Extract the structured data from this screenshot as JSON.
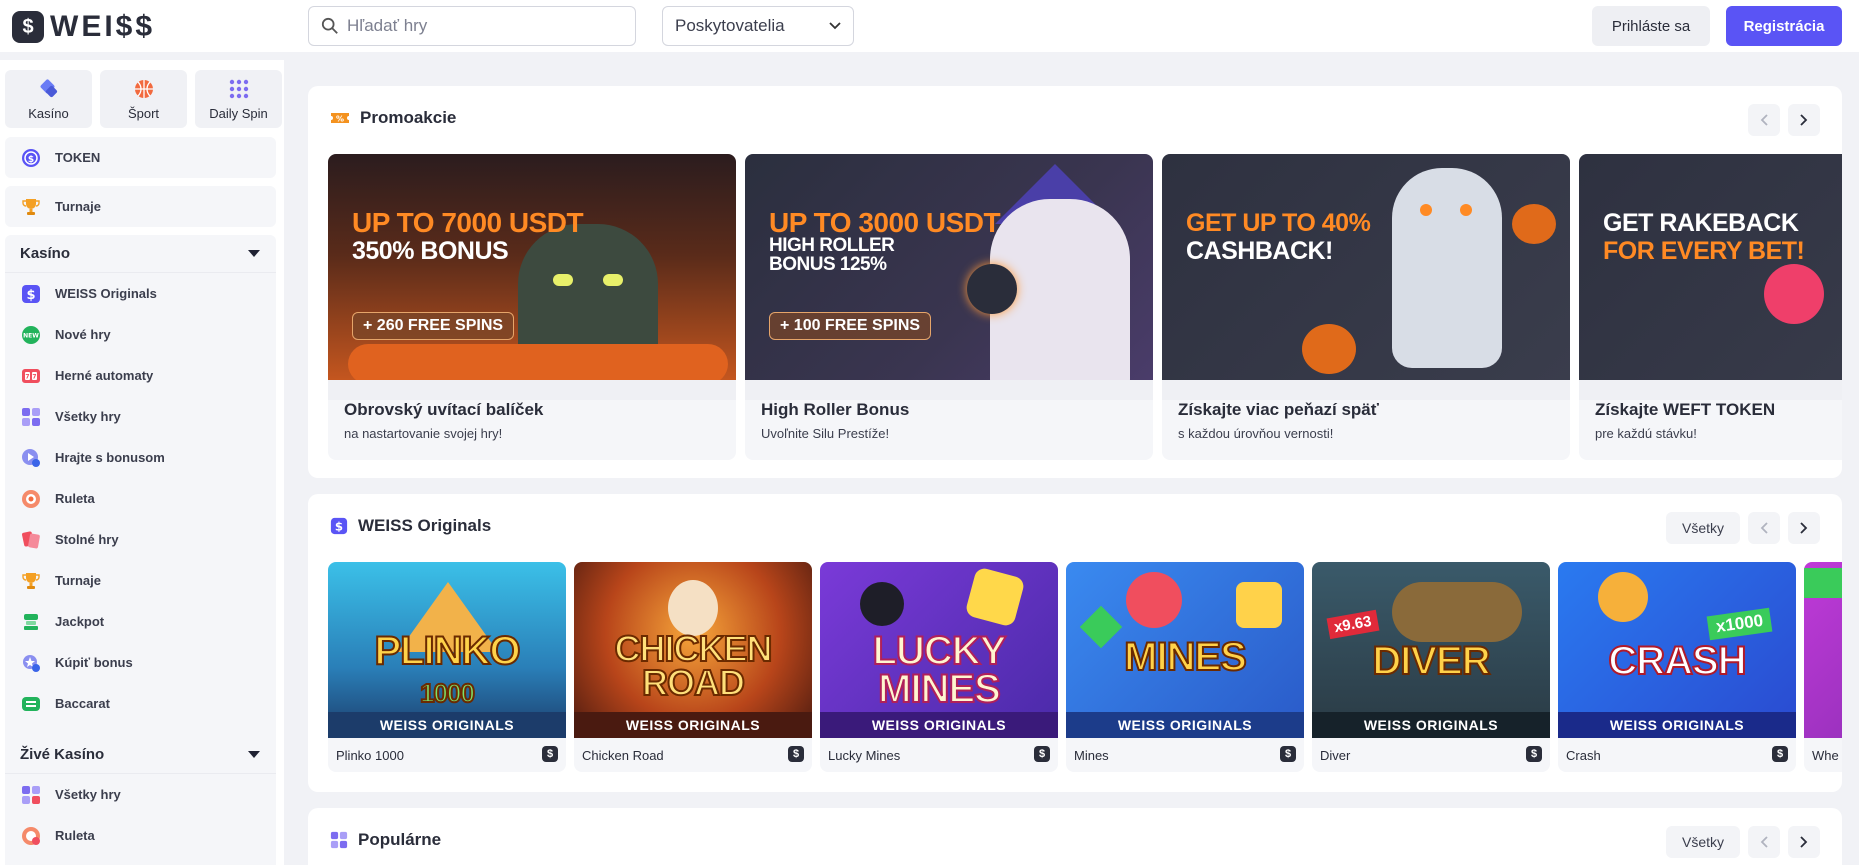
{
  "header": {
    "logo_mark": "$",
    "logo_text": "WEI$$",
    "search_placeholder": "Hľadať hry",
    "providers_label": "Poskytovatelia",
    "login_label": "Prihláste sa",
    "register_label": "Registrácia"
  },
  "sidebar": {
    "top_tabs": [
      {
        "label": "Kasíno",
        "icon": "casino-chips-icon"
      },
      {
        "label": "Šport",
        "icon": "basketball-icon"
      },
      {
        "label": "Daily Spin",
        "icon": "grid-dots-icon"
      }
    ],
    "token_label": "TOKEN",
    "tournaments_label": "Turnaje",
    "casino_section": {
      "title": "Kasíno",
      "items": [
        {
          "label": "WEISS Originals",
          "icon": "weiss-icon"
        },
        {
          "label": "Nové hry",
          "icon": "new-badge-icon"
        },
        {
          "label": "Herné automaty",
          "icon": "slot-machine-icon"
        },
        {
          "label": "Všetky hry",
          "icon": "grid-icon"
        },
        {
          "label": "Hrajte s bonusom",
          "icon": "bonus-play-icon"
        },
        {
          "label": "Ruleta",
          "icon": "roulette-icon"
        },
        {
          "label": "Stolné hry",
          "icon": "cards-icon"
        },
        {
          "label": "Turnaje",
          "icon": "trophy-icon"
        },
        {
          "label": "Jackpot",
          "icon": "jackpot-icon"
        },
        {
          "label": "Kúpiť bonus",
          "icon": "buy-bonus-icon"
        },
        {
          "label": "Baccarat",
          "icon": "baccarat-icon"
        }
      ]
    },
    "live_section": {
      "title": "Živé Kasíno",
      "items": [
        {
          "label": "Všetky hry",
          "icon": "live-grid-icon"
        },
        {
          "label": "Ruleta",
          "icon": "live-roulette-icon"
        }
      ]
    }
  },
  "promos": {
    "title": "Promoakcie",
    "cards": [
      {
        "headline1": "UP TO 7000 USDT",
        "headline2": "350% BONUS",
        "tag": "+ 260 FREE SPINS",
        "title": "Obrovský uvítací balíček",
        "subtitle": "na nastartovanie svojej hry!"
      },
      {
        "headline1": "UP TO 3000 USDT",
        "headline2": "HIGH ROLLER",
        "headline3": "BONUS 125%",
        "tag": "+ 100 FREE SPINS",
        "title": "High Roller Bonus",
        "subtitle": "Uvoľnite Silu Prestíže!"
      },
      {
        "headline1": "GET UP TO 40%",
        "headline2": "CASHBACK!",
        "title": "Získajte viac peňazí späť",
        "subtitle": "s každou úrovňou vernosti!"
      },
      {
        "headline1": "GET RAKEBACK",
        "headline2": "FOR EVERY BET!",
        "title": "Získajte WEFT TOKEN",
        "subtitle": "pre každú stávku!"
      }
    ]
  },
  "originals": {
    "title": "WEISS Originals",
    "all_label": "Všetky",
    "band_label": "WEISS ORIGINALS",
    "games": [
      {
        "name": "Plinko 1000",
        "logo": "PLINKO",
        "logo2": "1000"
      },
      {
        "name": "Chicken Road",
        "logo": "CHICKEN",
        "logo2": "ROAD"
      },
      {
        "name": "Lucky Mines",
        "logo": "LUCKY",
        "logo2": "MINES"
      },
      {
        "name": "Mines",
        "logo": "MINES",
        "logo2": ""
      },
      {
        "name": "Diver",
        "logo": "DIVER",
        "logo2": "",
        "multiplier": "x9.63"
      },
      {
        "name": "Crash",
        "logo": "CRASH",
        "logo2": "",
        "multiplier": "x1000"
      },
      {
        "name": "Whe"
      }
    ]
  },
  "popular": {
    "title": "Populárne",
    "all_label": "Všetky"
  }
}
